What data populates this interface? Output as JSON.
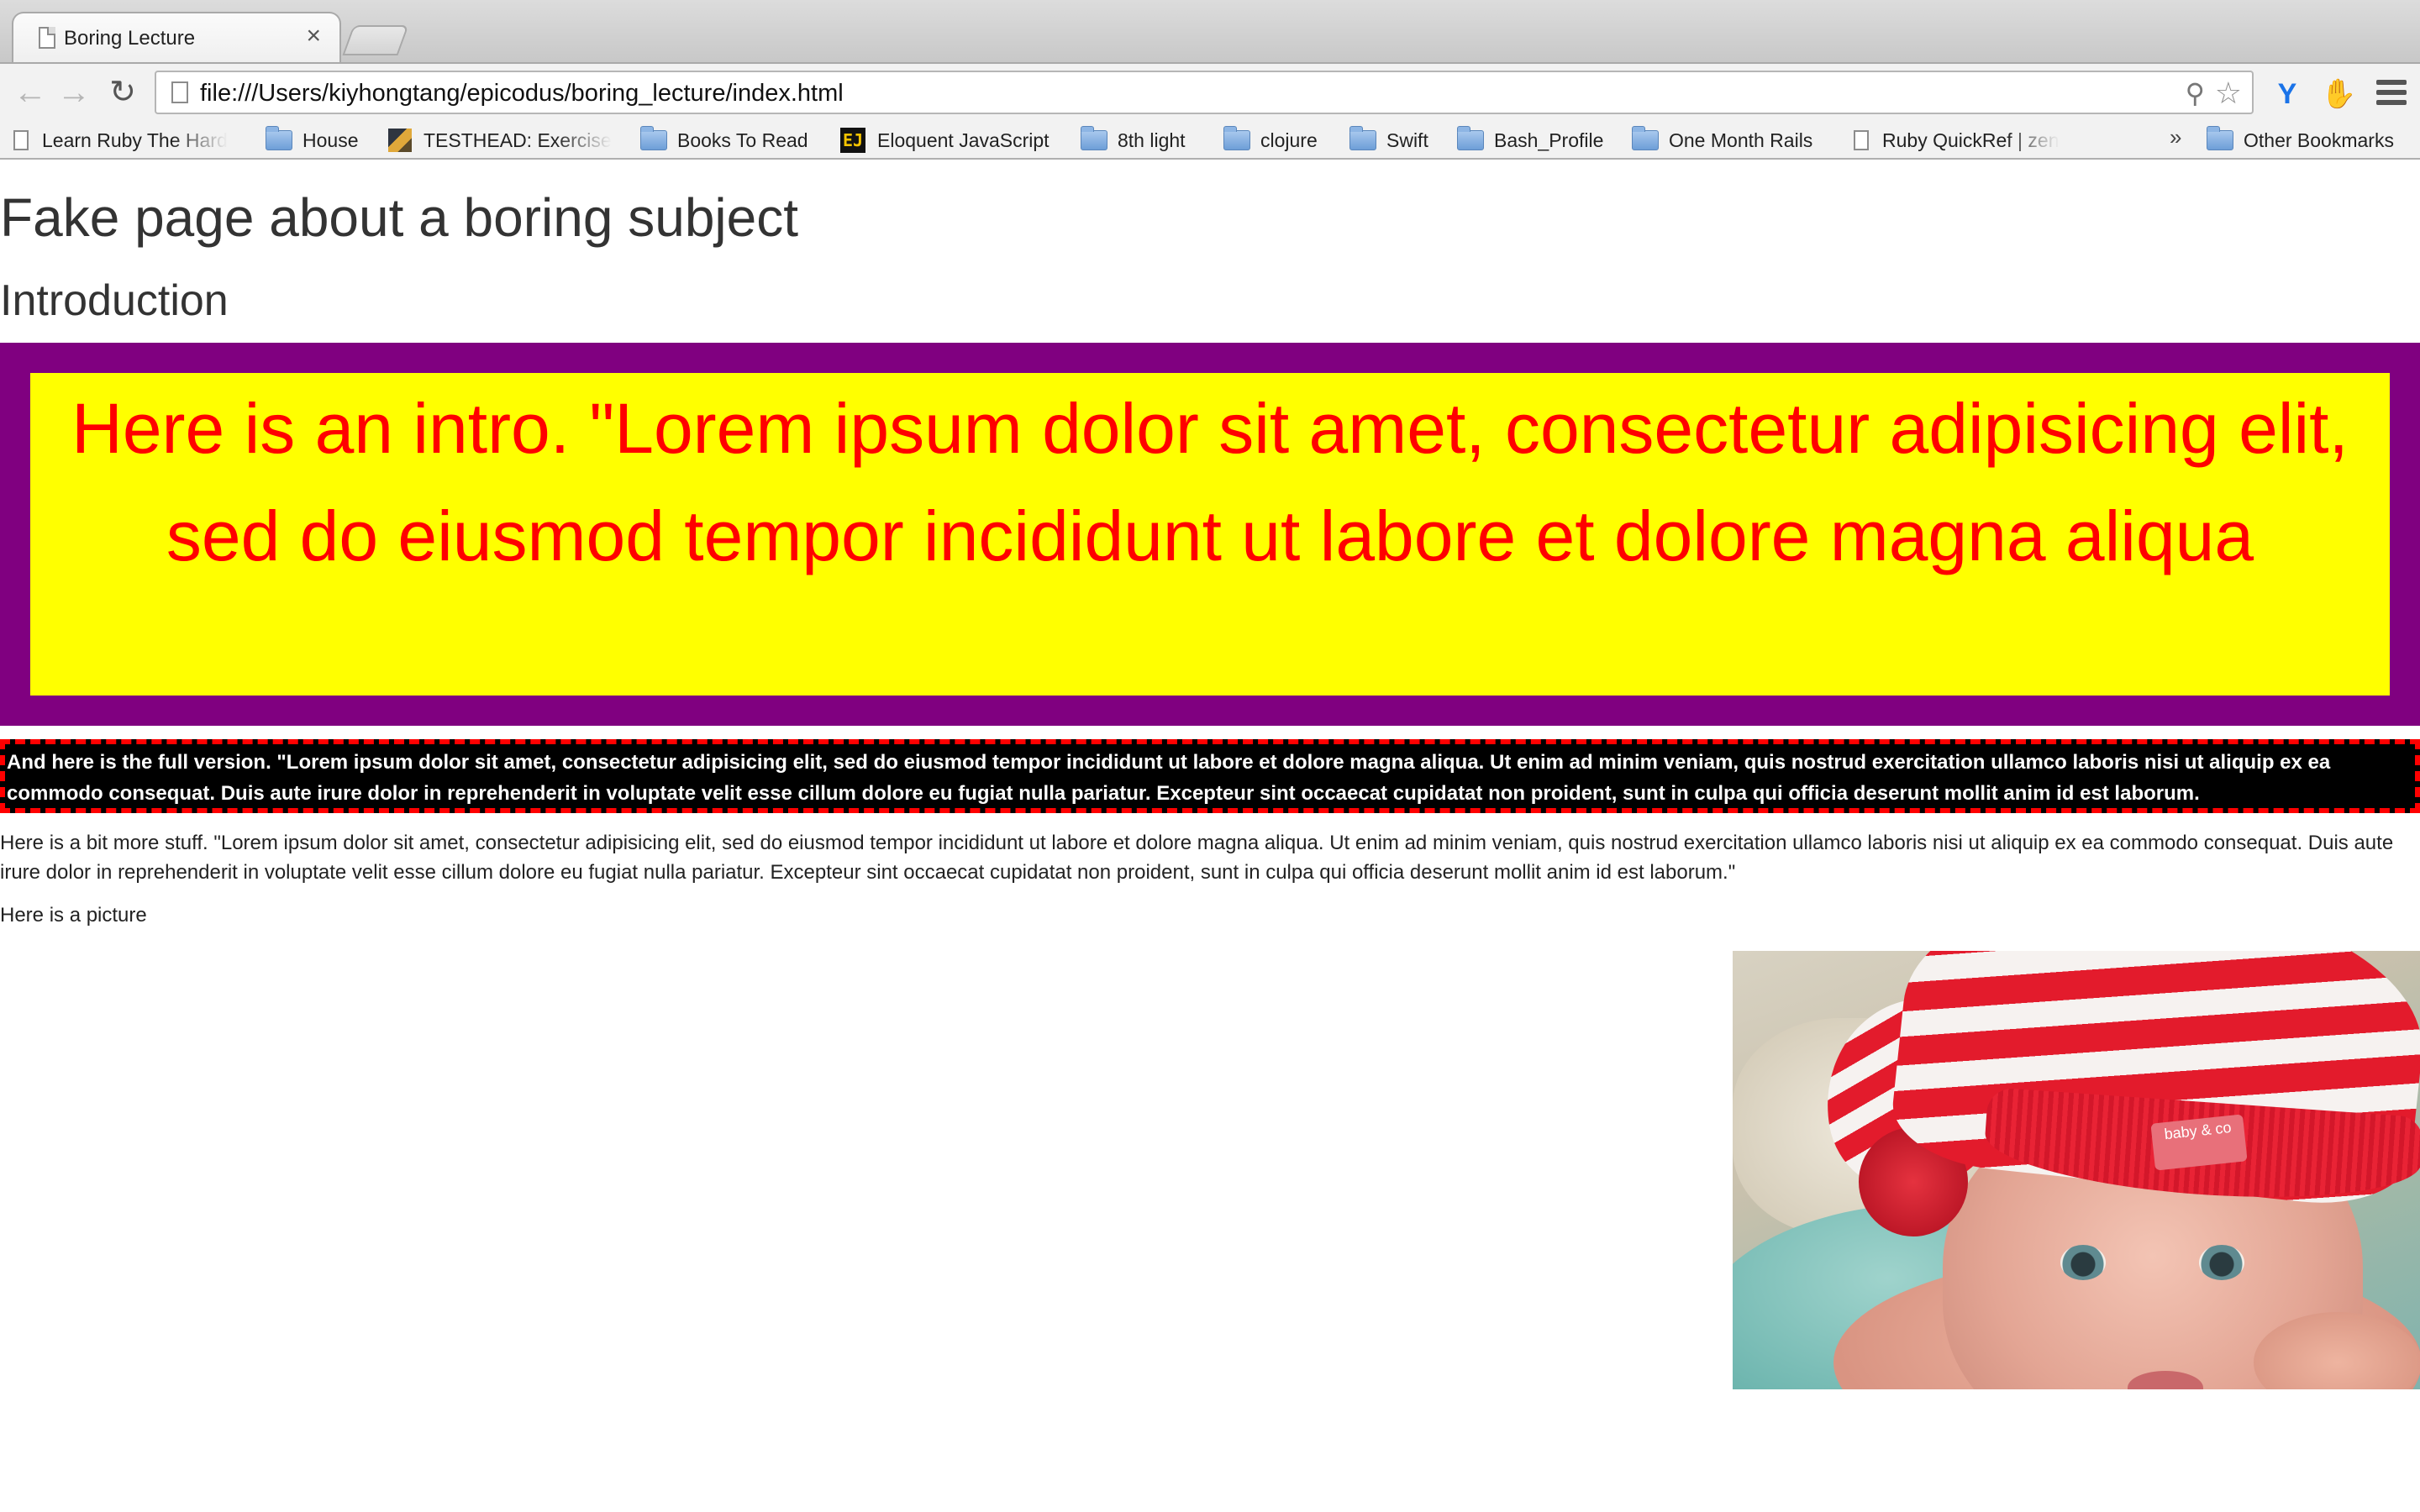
{
  "browser": {
    "tab_title": "Boring Lecture",
    "tab_close": "×",
    "url": "file:///Users/kiyhongtang/epicodus/boring_lecture/index.html",
    "bookmarks": [
      {
        "label": "Learn Ruby The Hard",
        "icon": "page-icon"
      },
      {
        "label": "House",
        "icon": "folder-icon"
      },
      {
        "label": "TESTHEAD: Exercise",
        "icon": "testhead-favicon"
      },
      {
        "label": "Books To Read",
        "icon": "folder-icon"
      },
      {
        "label": "Eloquent JavaScript",
        "icon": "eloquent-js-favicon"
      },
      {
        "label": "8th light",
        "icon": "folder-icon"
      },
      {
        "label": "clojure",
        "icon": "folder-icon"
      },
      {
        "label": "Swift",
        "icon": "folder-icon"
      },
      {
        "label": "Bash_Profile",
        "icon": "folder-icon"
      },
      {
        "label": "One Month Rails",
        "icon": "folder-icon"
      },
      {
        "label": "Ruby QuickRef | zen",
        "icon": "page-icon"
      }
    ],
    "bookmarks_overflow": "»",
    "other_bookmarks": "Other Bookmarks",
    "ejs_favicon_text": "EJ"
  },
  "page": {
    "title": "Fake page about a boring subject",
    "intro_heading": "Introduction",
    "intro_text": "Here is an intro. \"Lorem ipsum dolor sit amet, consectetur adipisicing elit, sed do eiusmod tempor incididunt ut labore et dolore magna aliqua",
    "full_version": "And here is the full version. \"Lorem ipsum dolor sit amet, consectetur adipisicing elit, sed do eiusmod tempor incididunt ut labore et dolore magna aliqua. Ut enim ad minim veniam, quis nostrud exercitation ullamco laboris nisi ut aliquip ex ea commodo consequat. Duis aute irure dolor in reprehenderit in voluptate velit esse cillum dolore eu fugiat nulla pariatur. Excepteur sint occaecat cupidatat non proident, sunt in culpa qui officia deserunt mollit anim id est laborum.",
    "more_stuff": "Here is a bit more stuff. \"Lorem ipsum dolor sit amet, consectetur adipisicing elit, sed do eiusmod tempor incididunt ut labore et dolore magna aliqua. Ut enim ad minim veniam, quis nostrud exercitation ullamco laboris nisi ut aliquip ex ea commodo consequat. Duis aute irure dolor in reprehenderit in voluptate velit esse cillum dolore eu fugiat nulla pariatur. Excepteur sint occaecat cupidatat non proident, sunt in culpa qui officia deserunt mollit anim id est laborum.\"",
    "picture_label": "Here is a picture",
    "hat_label": "baby & co"
  },
  "colors": {
    "intro_border": "#800080",
    "intro_background": "#ffff00",
    "intro_text": "#ff0000",
    "full_version_background": "#000000",
    "full_version_border": "#ff0000",
    "full_version_text": "#ffffff"
  }
}
